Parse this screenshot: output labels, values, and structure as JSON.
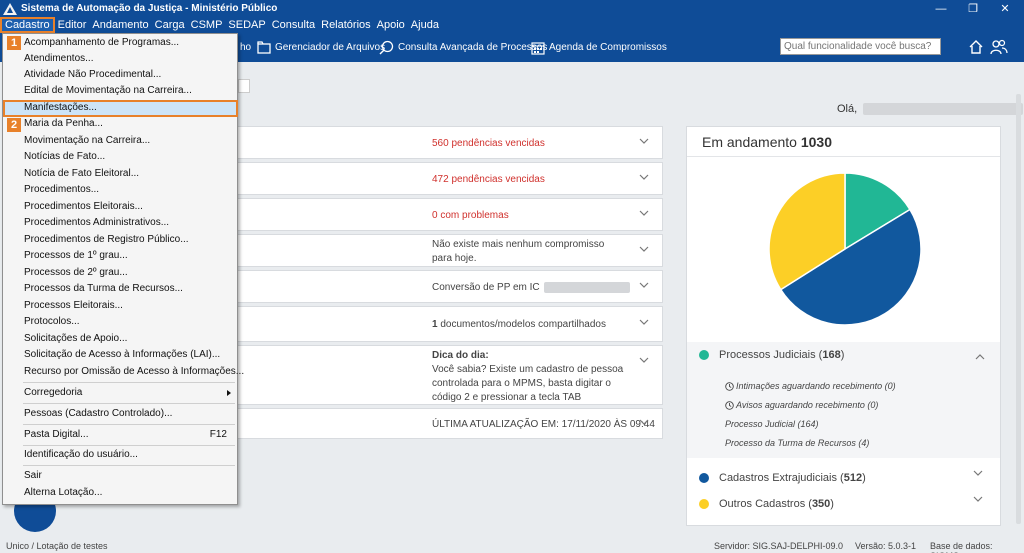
{
  "window": {
    "title": "Sistema de Automação da Justiça - Ministério Público",
    "minimize": "—",
    "restore": "❐",
    "close": "✕"
  },
  "menubar": {
    "items": [
      "Cadastro",
      "Editor",
      "Andamento",
      "Carga",
      "CSMP",
      "SEDAP",
      "Consulta",
      "Relatórios",
      "Apoio",
      "Ajuda"
    ]
  },
  "toolbar": {
    "partial": "ho",
    "file_manager": "Gerenciador de Arquivos",
    "advanced_search": "Consulta Avançada de Processos",
    "calendar": "Agenda de Compromissos",
    "search_placeholder": "Qual funcionalidade você busca?"
  },
  "greeting": "Olá,",
  "rows": [
    {
      "highlight": "560",
      "text": " pendências vencidas"
    },
    {
      "highlight": "472",
      "text": " pendências vencidas"
    },
    {
      "highlight": "0",
      "text": " com problemas"
    },
    {
      "text": "Não existe mais nenhum compromisso para hoje."
    },
    {
      "text": "Conversão de PP em IC"
    },
    {
      "bold": "1",
      "text": " documentos/modelos compartilhados"
    },
    {
      "bold": "Dica do dia:",
      "text": "Você sabia? Existe um cadastro de pessoa controlada para o MPMS, basta digitar o código 2 e pressionar a tecla TAB"
    },
    {
      "text": "ÚLTIMA ATUALIZAÇÃO EM: 17/11/2020 ÀS 09:44"
    }
  ],
  "card": {
    "title": "Em andamento",
    "total": "1030",
    "legend": [
      {
        "label": "Processos Judiciais",
        "count": "168",
        "color": "#21b795"
      },
      {
        "label": "Cadastros Extrajudiciais",
        "count": "512",
        "color": "#11589e"
      },
      {
        "label": "Outros Cadastros",
        "count": "350",
        "color": "#fccf26"
      }
    ],
    "judicial_items": [
      "Intimações aguardando recebimento (0)",
      "Avisos aguardando recebimento (0)",
      "Processo Judicial (164)",
      "Processo da Turma de Recursos (4)"
    ]
  },
  "chart_data": {
    "type": "pie",
    "title": "Em andamento 1030",
    "categories": [
      "Processos Judiciais",
      "Cadastros Extrajudiciais",
      "Outros Cadastros"
    ],
    "values": [
      168,
      512,
      350
    ],
    "colors": [
      "#21b795",
      "#11589e",
      "#fccf26"
    ]
  },
  "dropdown": {
    "items": [
      {
        "label": "Acompanhamento de Programas..."
      },
      {
        "label": "Atendimentos..."
      },
      {
        "label": "Atividade Não Procedimental..."
      },
      {
        "label": "Edital de Movimentação na Carreira..."
      },
      {
        "label": "Manifestações..."
      },
      {
        "label": "Maria da Penha..."
      },
      {
        "label": "Movimentação na Carreira..."
      },
      {
        "label": "Notícias de Fato..."
      },
      {
        "label": "Notícia de Fato Eleitoral..."
      },
      {
        "label": "Procedimentos..."
      },
      {
        "label": "Procedimentos Eleitorais..."
      },
      {
        "label": "Procedimentos Administrativos..."
      },
      {
        "label": "Procedimentos de Registro Público..."
      },
      {
        "label": "Processos de 1º grau..."
      },
      {
        "label": "Processos de 2º grau..."
      },
      {
        "label": "Processos da Turma de Recursos..."
      },
      {
        "label": "Processos Eleitorais..."
      },
      {
        "label": "Protocolos..."
      },
      {
        "label": "Solicitações de Apoio..."
      },
      {
        "label": "Solicitação de Acesso à Informações (LAI)..."
      },
      {
        "label": "Recurso por Omissão de Acesso à Informações..."
      }
    ],
    "corregedoria": "Corregedoria",
    "pessoas": "Pessoas (Cadastro Controlado)...",
    "pasta_digital": "Pasta Digital...",
    "pasta_shortcut": "F12",
    "identificacao": "Identificação do usuário...",
    "sair": "Sair",
    "alterna": "Alterna Lotação...",
    "badge1": "1",
    "badge2": "2"
  },
  "status": {
    "left": "Unico / Lotação de testes",
    "server": "Servidor: SIG.SAJ-DELPHI-09.0",
    "version": "Versão: 5.0.3-1",
    "db": "Base de dados: SIGMS"
  }
}
